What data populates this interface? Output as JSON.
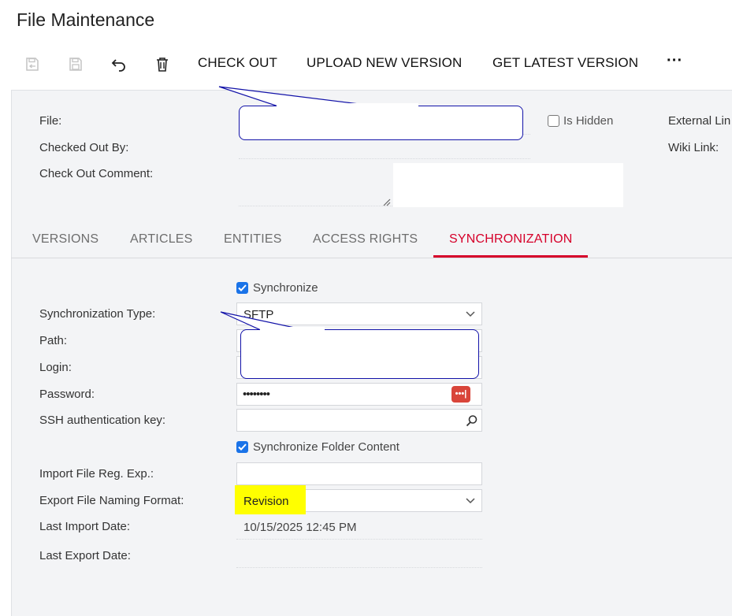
{
  "title": "File Maintenance",
  "toolbar": {
    "save_close_icon": "save-close-icon",
    "save_icon": "save-icon",
    "undo_icon": "undo-icon",
    "delete_icon": "trash-icon",
    "check_out": "CHECK OUT",
    "upload_new_version": "UPLOAD NEW VERSION",
    "get_latest_version": "GET LATEST VERSION",
    "more": "···"
  },
  "header": {
    "file_label": "File:",
    "file_value": "",
    "is_hidden_label": "Is Hidden",
    "is_hidden_checked": false,
    "checked_out_by_label": "Checked Out By:",
    "check_out_comment_label": "Check Out Comment:",
    "external_link_label": "External Lin",
    "wiki_link_label": "Wiki Link:"
  },
  "tabs": [
    {
      "label": "VERSIONS",
      "active": false
    },
    {
      "label": "ARTICLES",
      "active": false
    },
    {
      "label": "ENTITIES",
      "active": false
    },
    {
      "label": "ACCESS RIGHTS",
      "active": false
    },
    {
      "label": "SYNCHRONIZATION",
      "active": true
    }
  ],
  "sync": {
    "synchronize_label": "Synchronize",
    "synchronize_checked": true,
    "sync_type_label": "Synchronization Type:",
    "sync_type_value": "SFTP",
    "path_label": "Path:",
    "login_label": "Login:",
    "password_label": "Password:",
    "password_value": "••••••••",
    "ssh_key_label": "SSH authentication key:",
    "sync_folder_label": "Synchronize Folder Content",
    "sync_folder_checked": true,
    "import_regexp_label": "Import File Reg. Exp.:",
    "export_naming_label": "Export File Naming Format:",
    "export_naming_value": "Revision",
    "last_import_label": "Last Import Date:",
    "last_import_value": "10/15/2025 12:45 PM",
    "last_export_label": "Last Export Date:",
    "last_export_value": ""
  },
  "colors": {
    "accent_active_tab": "#d6002a",
    "checkbox": "#1a73e8",
    "callout_border": "#1212a8",
    "highlight": "#ffff00",
    "password_reveal": "#d9453a"
  }
}
